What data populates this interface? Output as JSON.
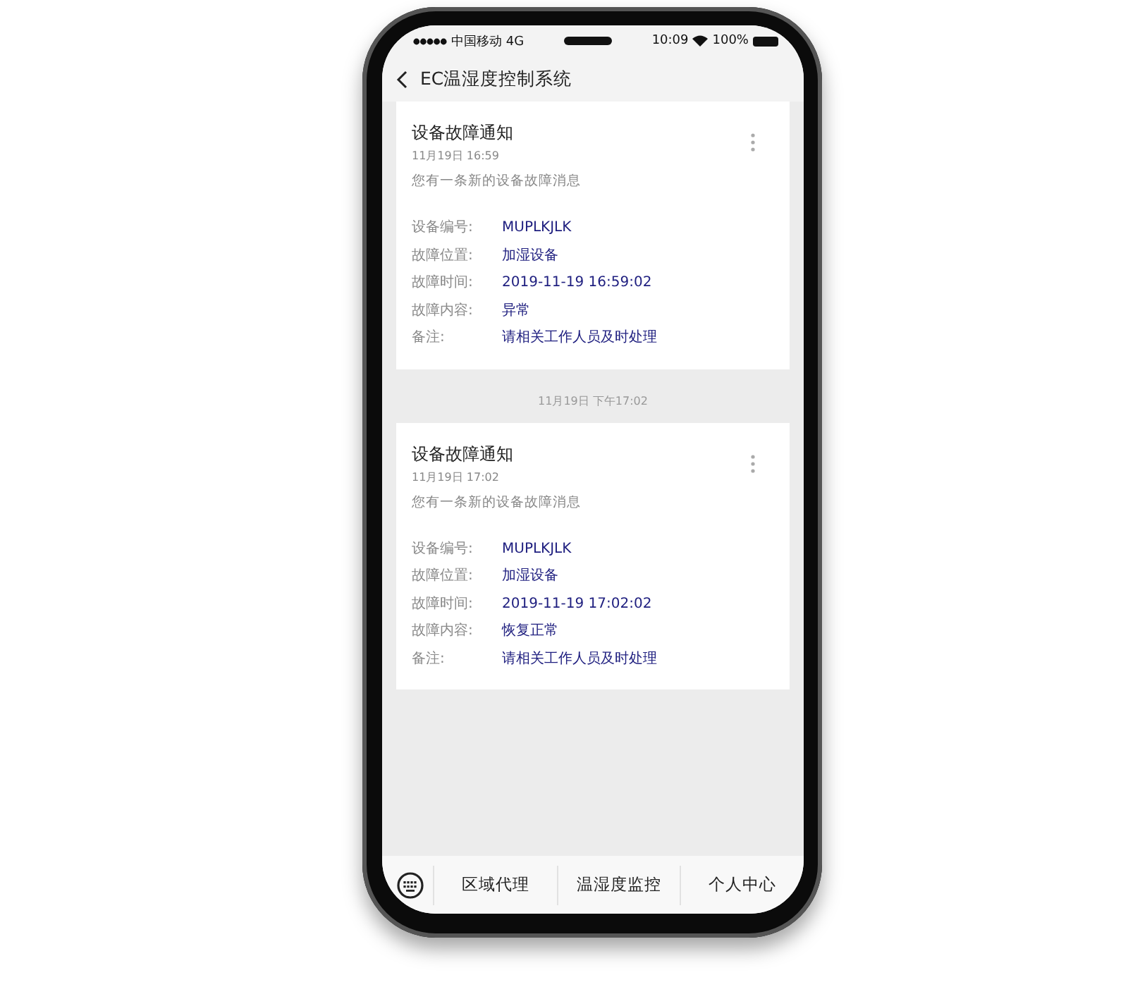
{
  "status_bar": {
    "carrier": "中国移动 4G",
    "time": "10:09",
    "battery": "100%"
  },
  "header": {
    "title": "EC温湿度控制系统"
  },
  "messages": [
    {
      "title": "设备故障通知",
      "date": "11月19日  16:59",
      "summary": "您有一条新的设备故障消息",
      "fields": [
        {
          "label": "设备编号:",
          "value": "MUPLKJLK"
        },
        {
          "label": "故障位置:",
          "value": "加湿设备"
        },
        {
          "label": "故障时间:",
          "value": "2019-11-19 16:59:02"
        },
        {
          "label": "故障内容:",
          "value": "异常"
        },
        {
          "label": "备注:",
          "value": "请相关工作人员及时处理"
        }
      ]
    },
    {
      "timestamp": "11月19日 下午17:02",
      "title": "设备故障通知",
      "date": "11月19日  17:02",
      "summary": "您有一条新的设备故障消息",
      "fields": [
        {
          "label": "设备编号:",
          "value": "MUPLKJLK"
        },
        {
          "label": "故障位置:",
          "value": "加湿设备"
        },
        {
          "label": "故障时间:",
          "value": "2019-11-19 17:02:02"
        },
        {
          "label": "故障内容:",
          "value": "恢复正常"
        },
        {
          "label": "备注:",
          "value": "请相关工作人员及时处理"
        }
      ]
    }
  ],
  "nav": {
    "items": [
      "区域代理",
      "温湿度监控",
      "个人中心"
    ]
  }
}
